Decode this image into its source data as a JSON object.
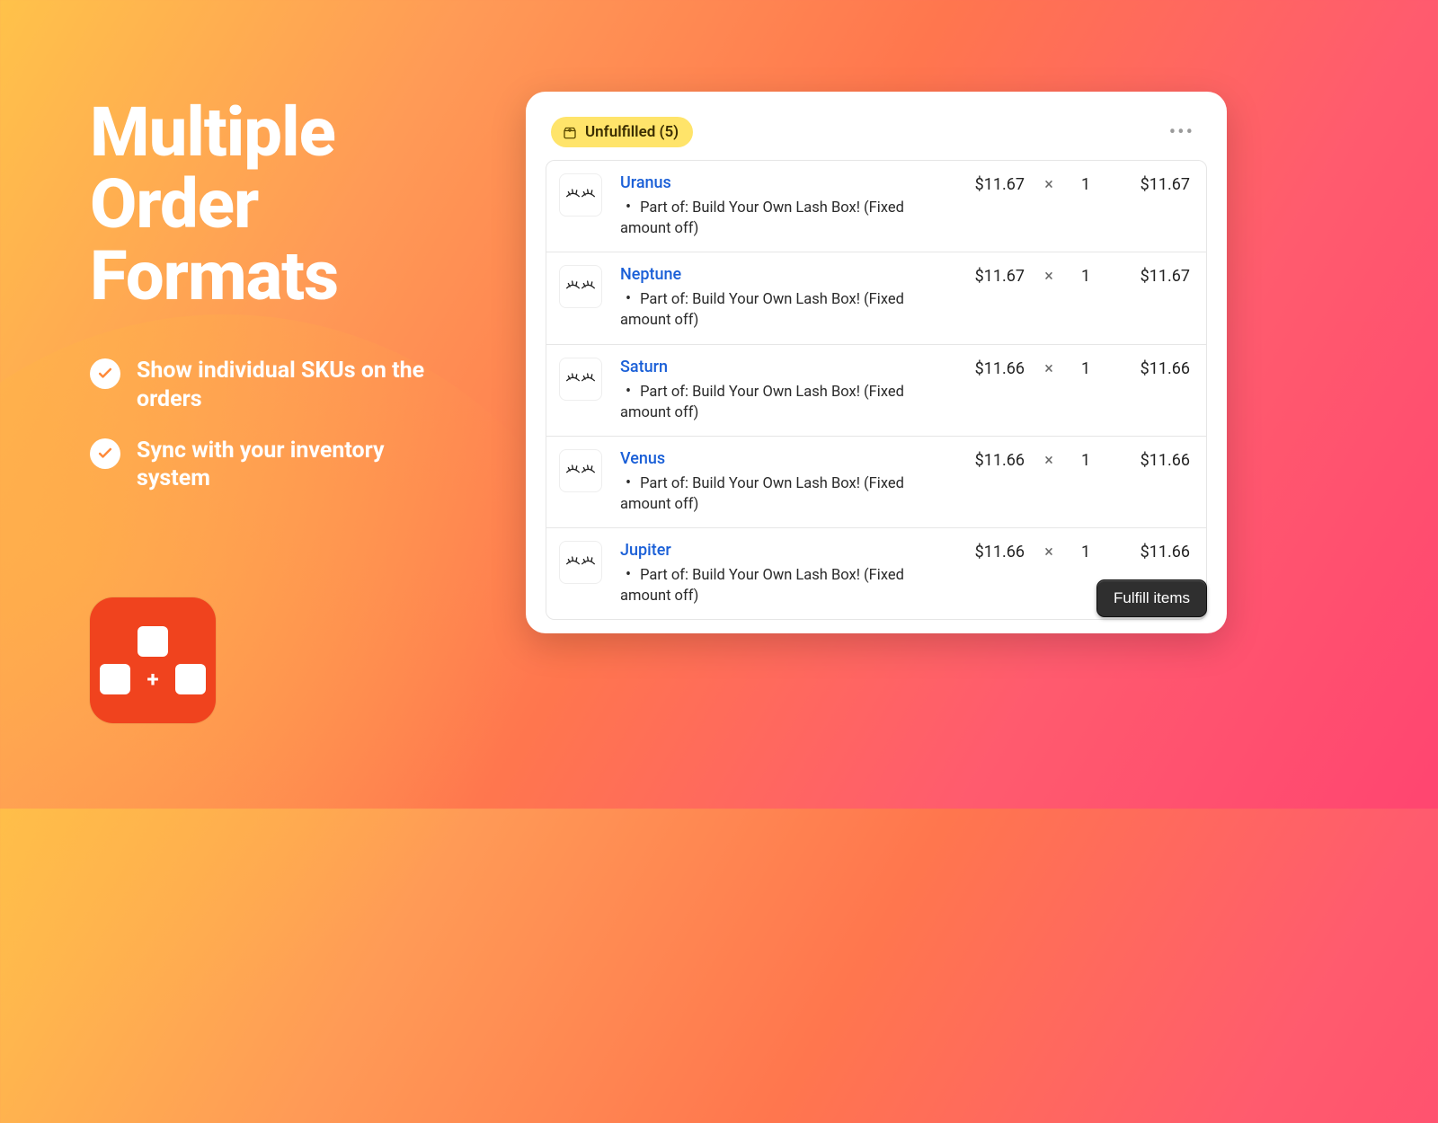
{
  "hero": {
    "title_line1": "Multiple",
    "title_line2": "Order",
    "title_line3": "Formats",
    "feature1": "Show individual SKUs on the orders",
    "feature2": "Sync with your inventory system"
  },
  "card": {
    "badge_label": "Unfulfilled (5)",
    "fulfill_label": "Fulfill items",
    "mult_symbol": "×",
    "items": [
      {
        "name": "Uranus",
        "sub": "Part of: Build Your Own Lash Box! (Fixed amount off)",
        "price": "$11.67",
        "qty": "1",
        "total": "$11.67"
      },
      {
        "name": "Neptune",
        "sub": "Part of: Build Your Own Lash Box! (Fixed amount off)",
        "price": "$11.67",
        "qty": "1",
        "total": "$11.67"
      },
      {
        "name": "Saturn",
        "sub": "Part of: Build Your Own Lash Box! (Fixed amount off)",
        "price": "$11.66",
        "qty": "1",
        "total": "$11.66"
      },
      {
        "name": "Venus",
        "sub": "Part of: Build Your Own Lash Box! (Fixed amount off)",
        "price": "$11.66",
        "qty": "1",
        "total": "$11.66"
      },
      {
        "name": "Jupiter",
        "sub": "Part of: Build Your Own Lash Box! (Fixed amount off)",
        "price": "$11.66",
        "qty": "1",
        "total": "$11.66"
      }
    ]
  }
}
